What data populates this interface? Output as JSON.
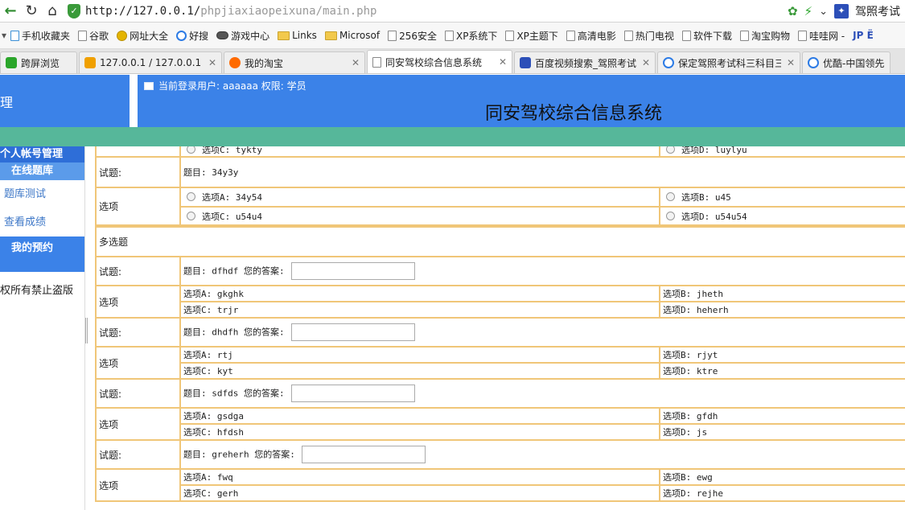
{
  "browser": {
    "url_host": "http://127.0.0.1/",
    "url_path": "phpjiaxiaopeixuna/main.php",
    "search_engine": "驾照考试",
    "bookmarks": [
      "手机收藏夹",
      "谷歌",
      "网址大全",
      "好搜",
      "游戏中心",
      "Links",
      "Microsof",
      "256安全",
      "XP系统下",
      "XP主题下",
      "高清电影",
      "热门电视",
      "软件下载",
      "淘宝购物",
      "哇哇网 -",
      "JP Ë"
    ],
    "tabs": [
      {
        "title": "跨屏浏览"
      },
      {
        "title": "127.0.0.1 / 127.0.0.1"
      },
      {
        "title": "我的淘宝"
      },
      {
        "title": "同安驾校综合信息系统"
      },
      {
        "title": "百度视频搜索_驾照考试"
      },
      {
        "title": "保定驾照考试科三科目三"
      },
      {
        "title": "优酷-中国领先"
      }
    ]
  },
  "header": {
    "left_text": "理",
    "user_line": "当前登录用户: aaaaaa 权限: 学员",
    "system_title": "同安驾校综合信息系统"
  },
  "sidebar": {
    "section": "个人帐号管理",
    "online_bank": "在线题库",
    "links": [
      "题库测试",
      "查看成绩"
    ],
    "my_booking": "我的预约",
    "footer": "权所有禁止盗版"
  },
  "quiz": {
    "partial_options": {
      "c": "选项C: tykty",
      "d": "选项D: luylyu"
    },
    "single_q": {
      "label_q": "试题:",
      "question": "题目: 34y3y",
      "label_opt": "选项",
      "a": "选项A: 34y54",
      "b": "选项B: u45",
      "c": "选项C: u54u4",
      "d": "选项D: u54u54"
    },
    "multi_title": "多选题",
    "multi": [
      {
        "label_q": "试题:",
        "question": "题目: dfhdf 您的答案:",
        "label_opt": "选项",
        "a": "选项A: gkghk",
        "b": "选项B: jheth",
        "c": "选项C: trjr",
        "d": "选项D: heherh"
      },
      {
        "label_q": "试题:",
        "question": "题目: dhdfh 您的答案:",
        "label_opt": "选项",
        "a": "选项A: rtj",
        "b": "选项B: rjyt",
        "c": "选项C: kyt",
        "d": "选项D: ktre"
      },
      {
        "label_q": "试题:",
        "question": "题目: sdfds 您的答案:",
        "label_opt": "选项",
        "a": "选项A: gsdga",
        "b": "选项B: gfdh",
        "c": "选项C: hfdsh",
        "d": "选项D: js"
      },
      {
        "label_q": "试题:",
        "question": "题目: greherh 您的答案:",
        "label_opt": "选项",
        "a": "选项A: fwq",
        "b": "选项B: ewg",
        "c": "选项C: gerh",
        "d": "选项D: rejhe"
      }
    ]
  }
}
